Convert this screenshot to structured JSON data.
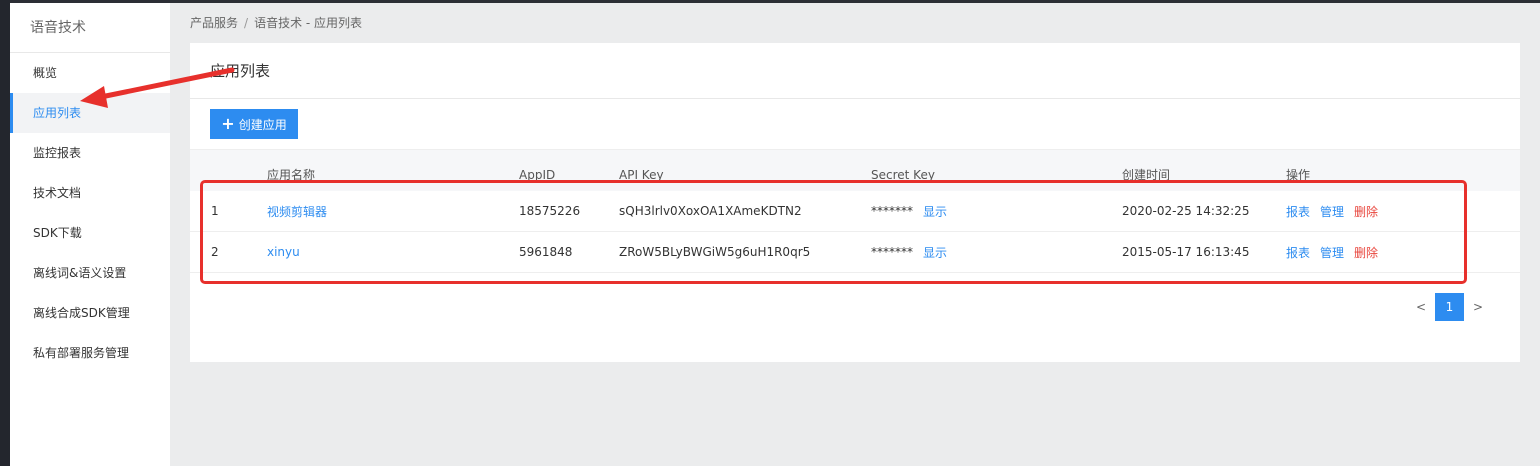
{
  "sidebar": {
    "title": "语音技术",
    "items": [
      {
        "label": "概览"
      },
      {
        "label": "应用列表",
        "active": true
      },
      {
        "label": "监控报表"
      },
      {
        "label": "技术文档"
      },
      {
        "label": "SDK下载"
      },
      {
        "label": "离线词&语义设置"
      },
      {
        "label": "离线合成SDK管理"
      },
      {
        "label": "私有部署服务管理"
      }
    ]
  },
  "breadcrumb": {
    "first": "产品服务",
    "separator": "/",
    "second": "语音技术 - 应用列表"
  },
  "main": {
    "title": "应用列表",
    "create_button": {
      "icon": "plus-icon",
      "label": "创建应用"
    },
    "table": {
      "headers": [
        "应用名称",
        "AppID",
        "API Key",
        "Secret Key",
        "创建时间",
        "操作"
      ],
      "rows": [
        {
          "index": "1",
          "name": "视频剪辑器",
          "app_id": "18575226",
          "api_key": "sQH3lrlv0XoxOA1XAmeKDTN2",
          "secret_mask": "*******",
          "secret_show": "显示",
          "created": "2020-02-25 14:32:25",
          "actions": {
            "report": "报表",
            "manage": "管理",
            "delete": "删除"
          }
        },
        {
          "index": "2",
          "name": "xinyu",
          "app_id": "5961848",
          "api_key": "ZRoW5BLyBWGiW5g6uH1R0qr5",
          "secret_mask": "*******",
          "secret_show": "显示",
          "created": "2015-05-17 16:13:45",
          "actions": {
            "report": "报表",
            "manage": "管理",
            "delete": "删除"
          }
        }
      ]
    },
    "pagination": {
      "prev": "<",
      "current": "1",
      "next": ">"
    }
  },
  "colors": {
    "accent": "#2d8cf0",
    "danger": "#e8453c",
    "annotation": "#e7302c"
  }
}
